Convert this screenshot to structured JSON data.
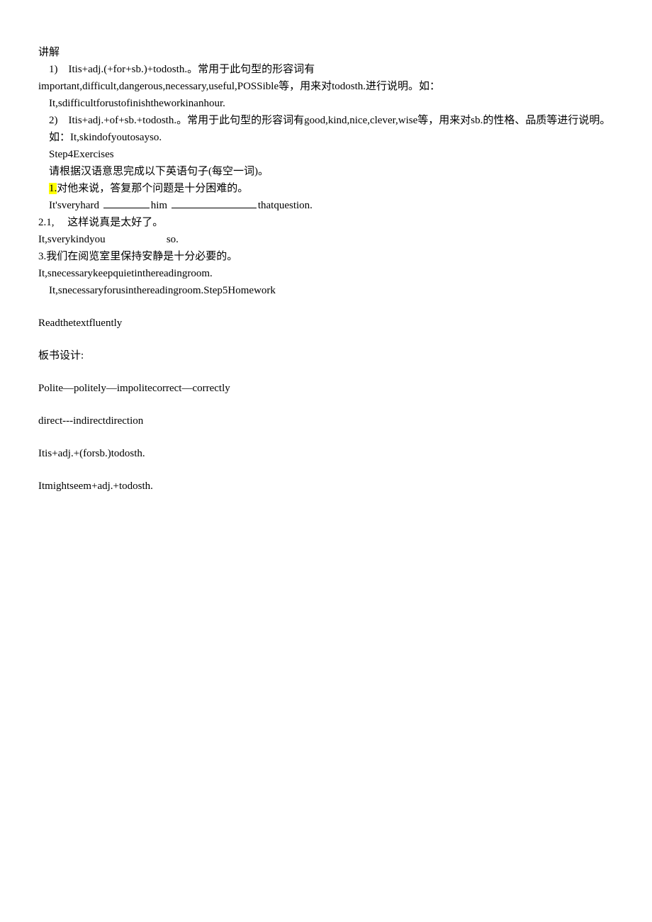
{
  "heading": "讲解",
  "l1": "　1)　Itis+adj.(+for+sb.)+todosth.。常用于此句型的形容词有",
  "l2": "important,difficult,dangerous,necessary,useful,POSSible等，用来对todosth.进行说明。如：",
  "l3": "　It,sdifficultforustofinishtheworkinanhour.",
  "l4": "　2)　Itis+adj.+of+sb.+todosth.。常用于此句型的形容词有good,kind,nice,clever,wise等，用来对sb.的性格、品质等进行说明。",
  "l5": "　如：It,skindofyoutosayso.",
  "l6": "　Step4Exercises",
  "l7": "　请根据汉语意思完成以下英语句子(每空一词)。",
  "l8a": "　",
  "l8hl": "1.",
  "l8b": "对他来说，答复那个问题是十分困难的。",
  "l9a": "　It'sveryhard ",
  "l9b": "him ",
  "l9c": "thatquestion.",
  "l10": "2.1,　 这样说真是太好了。",
  "l11": "It,sverykindyou                       so.",
  "l12": "3.我们在阅览室里保持安静是十分必要的。",
  "l13": "It,snecessarykeepquietinthereadingroom.",
  "l14": "　It,snecessaryforusinthereadingroom.Step5Homework",
  "l15": "Readthetextfluently",
  "l16": "板书设计:",
  "l17": "Polite—politely—impolitecorrect—correctly",
  "l18": "direct---indirectdirection",
  "l19": "Itis+adj.+(forsb.)todosth.",
  "l20": "Itmightseem+adj.+todosth."
}
